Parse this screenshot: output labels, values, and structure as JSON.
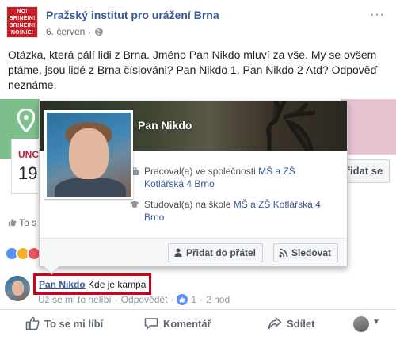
{
  "post": {
    "logo_lines": [
      "NO!",
      "BR!NEIN!",
      "BR!NEIN!",
      "NO!NIE!"
    ],
    "page_name": "Pražský institut pro urážení Brna",
    "date": "6. červen",
    "privacy_icon": "globe-icon",
    "more_label": "···",
    "text": "Otázka, která pálí lidi z Brna. Jméno Pan Nikdo mluví za vše. My se ovšem ptáme, jsou lidé z Brna číslováni? Pan Nikdo 1, Pan Nikdo 2 Atd? Odpověď neznáme."
  },
  "background": {
    "card_label_a": "UNC",
    "card_label_b": "19",
    "follow_label": "řidat se",
    "likes_label": "To s"
  },
  "hovercard": {
    "name": "Pan Nikdo",
    "work_prefix": "Pracoval(a) ve společnosti ",
    "work_place": "MŠ a ZŠ Kotlářská 4 Brno",
    "study_prefix": "Studoval(a) na škole ",
    "study_place": "MŠ a ZŠ Kotlářská 4 Brno",
    "add_friend_label": "Přidat do přátel",
    "follow_label": "Sledovat"
  },
  "comment": {
    "author": "Pan Nikdo",
    "text": "Kde je kampa",
    "unlike_label": "Už se mi to nelíbí",
    "reply_label": "Odpovědět",
    "like_count": "1",
    "time": "2 hod",
    "separator": "·"
  },
  "actions": {
    "like_label": "To se mi líbí",
    "comment_label": "Komentář",
    "share_label": "Sdílet"
  },
  "colors": {
    "brand_blue": "#385898",
    "highlight_red": "#d0021b",
    "logo_red": "#c81d26"
  }
}
